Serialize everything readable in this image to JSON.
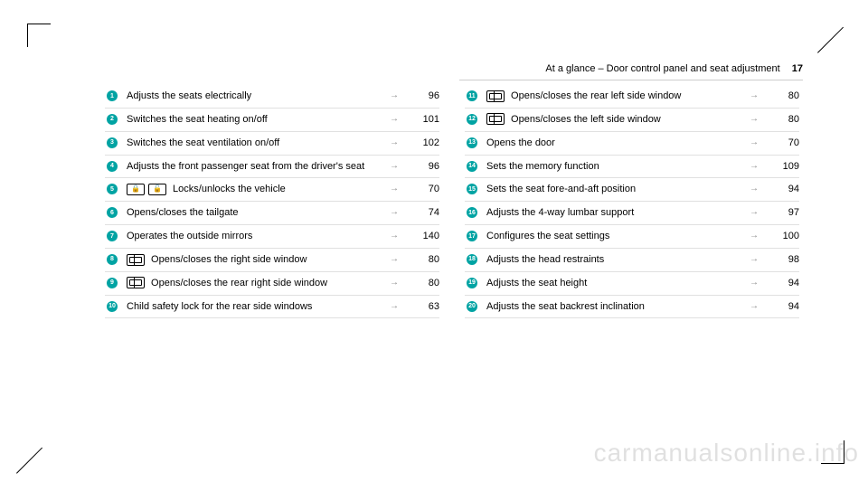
{
  "header": {
    "title": "At a glance – Door control panel and seat adjustment",
    "page": "17"
  },
  "arrow": "→",
  "watermark": "carmanualsonline.info",
  "left": [
    {
      "num": "1",
      "icons": [],
      "text": "Adjusts the seats electrically",
      "page": "96"
    },
    {
      "num": "2",
      "icons": [],
      "text": "Switches the seat heating on/off",
      "page": "101"
    },
    {
      "num": "3",
      "icons": [],
      "text": "Switches the seat ventilation on/off",
      "page": "102"
    },
    {
      "num": "4",
      "icons": [],
      "text": "Adjusts the front passenger seat from the driver's seat",
      "page": "96"
    },
    {
      "num": "5",
      "icons": [
        "lock",
        "unlock"
      ],
      "text": "Locks/unlocks the vehicle",
      "page": "70"
    },
    {
      "num": "6",
      "icons": [],
      "text": "Opens/closes the tailgate",
      "page": "74"
    },
    {
      "num": "7",
      "icons": [],
      "text": "Operates the outside mirrors",
      "page": "140"
    },
    {
      "num": "8",
      "icons": [
        "window"
      ],
      "text": "Opens/closes the right side window",
      "page": "80"
    },
    {
      "num": "9",
      "icons": [
        "window"
      ],
      "text": "Opens/closes the rear right side window",
      "page": "80"
    },
    {
      "num": "10",
      "icons": [],
      "text": "Child safety lock for the rear side windows",
      "page": "63"
    }
  ],
  "right": [
    {
      "num": "11",
      "icons": [
        "window"
      ],
      "text": "Opens/closes the rear left side window",
      "page": "80"
    },
    {
      "num": "12",
      "icons": [
        "window"
      ],
      "text": "Opens/closes the left side window",
      "page": "80"
    },
    {
      "num": "13",
      "icons": [],
      "text": "Opens the door",
      "page": "70"
    },
    {
      "num": "14",
      "icons": [],
      "text": "Sets the memory function",
      "page": "109"
    },
    {
      "num": "15",
      "icons": [],
      "text": "Sets the seat fore-and-aft position",
      "page": "94"
    },
    {
      "num": "16",
      "icons": [],
      "text": "Adjusts the 4-way lumbar support",
      "page": "97"
    },
    {
      "num": "17",
      "icons": [],
      "text": "Configures the seat settings",
      "page": "100"
    },
    {
      "num": "18",
      "icons": [],
      "text": "Adjusts the head restraints",
      "page": "98"
    },
    {
      "num": "19",
      "icons": [],
      "text": "Adjusts the seat height",
      "page": "94"
    },
    {
      "num": "20",
      "icons": [],
      "text": "Adjusts the seat backrest inclination",
      "page": "94"
    }
  ]
}
